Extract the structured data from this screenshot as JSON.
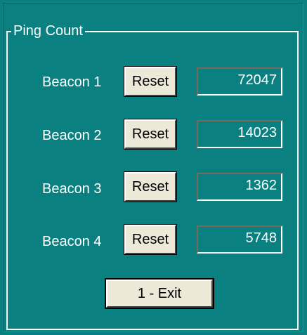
{
  "group": {
    "label": "Ping Count"
  },
  "beacons": [
    {
      "label": "Beacon 1",
      "reset_label": "Reset",
      "count": "72047"
    },
    {
      "label": "Beacon 2",
      "reset_label": "Reset",
      "count": "14023"
    },
    {
      "label": "Beacon 3",
      "reset_label": "Reset",
      "count": "1362"
    },
    {
      "label": "Beacon 4",
      "reset_label": "Reset",
      "count": "5748"
    }
  ],
  "exit_label": "1 - Exit",
  "colors": {
    "background": "#0a8080",
    "button_face": "#ece9d8",
    "text": "#ffffff"
  }
}
